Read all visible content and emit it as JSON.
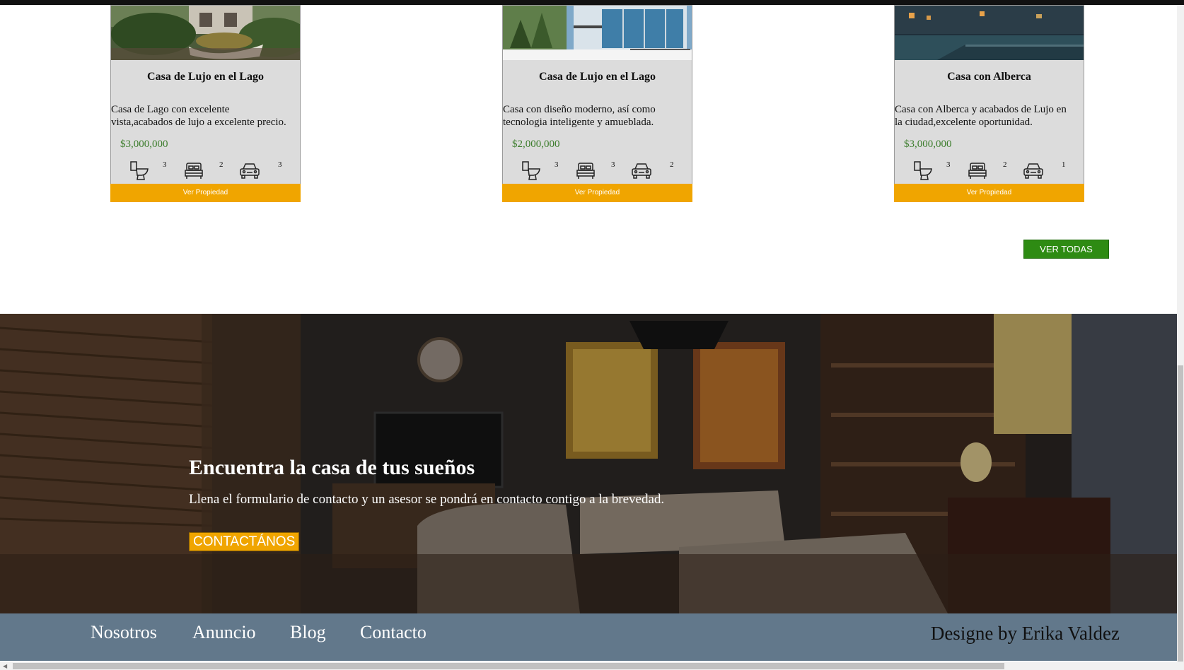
{
  "properties": [
    {
      "title": "Casa de Lujo en el Lago",
      "desc_line1": "Casa de Lago con excelente",
      "desc_line2": "vista,acabados de lujo a excelente precio.",
      "price": "$3,000,000",
      "bathrooms": "3",
      "bedrooms": "2",
      "parking": "3",
      "button": "Ver Propiedad"
    },
    {
      "title": "Casa de Lujo en el Lago",
      "desc_line1": "Casa con diseño moderno, así como",
      "desc_line2": "tecnologia inteligente y amueblada.",
      "price": "$2,000,000",
      "bathrooms": "3",
      "bedrooms": "3",
      "parking": "2",
      "button": "Ver Propiedad"
    },
    {
      "title": "Casa con Alberca",
      "desc_line1": "Casa con Alberca y acabados de Lujo en",
      "desc_line2": "la ciudad,excelente oportunidad.",
      "price": "$3,000,000",
      "bathrooms": "3",
      "bedrooms": "2",
      "parking": "1",
      "button": "Ver Propiedad"
    }
  ],
  "see_all_label": "VER TODAS",
  "hero": {
    "title": "Encuentra la casa de tus sueños",
    "subtitle": "Llena el formulario de contacto y un asesor se pondrá en contacto contigo a la brevedad.",
    "button": "CONTACTÁNOS"
  },
  "footer": {
    "nav": [
      "Nosotros",
      "Anuncio",
      "Blog",
      "Contacto"
    ],
    "credit": "Designe by Erika Valdez"
  },
  "colors": {
    "accent": "#f0a500",
    "price_green": "#3c7d2c",
    "button_green": "#2e8b13",
    "footer_bg": "#62788b"
  },
  "icons": [
    "toilet-icon",
    "bed-icon",
    "car-icon"
  ]
}
